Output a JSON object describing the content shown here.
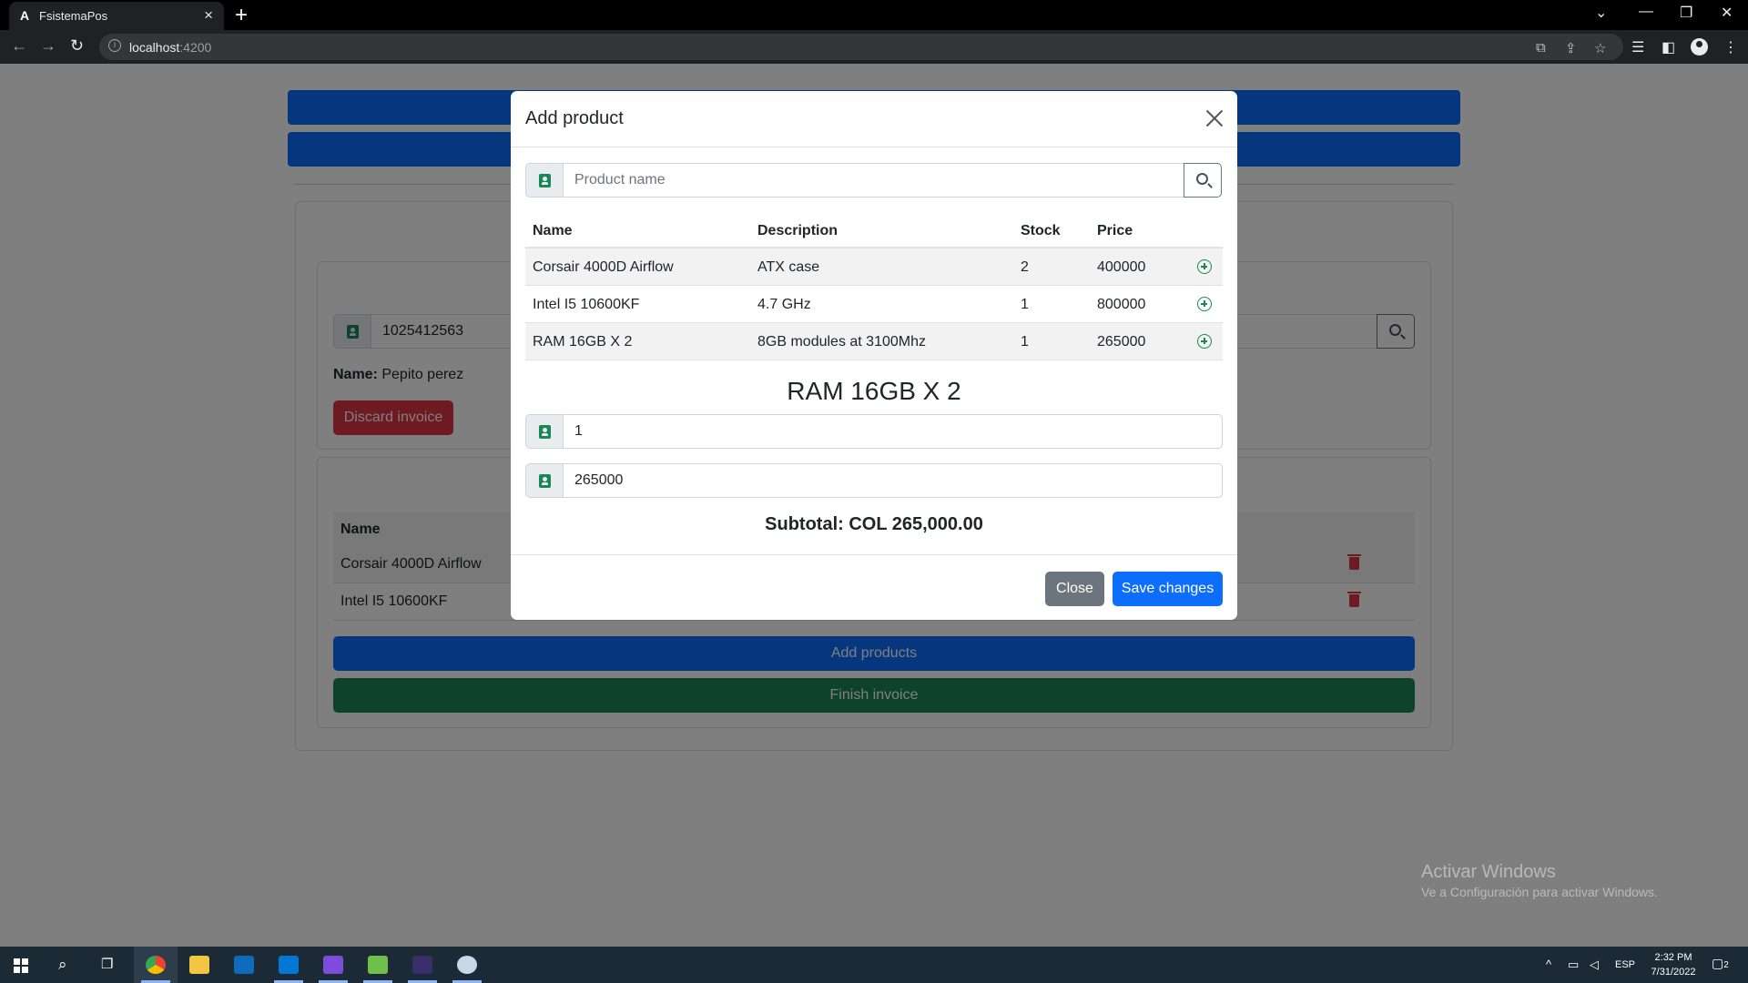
{
  "browser": {
    "tab_title": "FsistemaPos",
    "tab_favicon": "A",
    "url_host": "localhost",
    "url_port": ":4200"
  },
  "page": {
    "customer_id": "1025412563",
    "name_label": "Name:",
    "name_value": "Pepito perez",
    "discard_button": "Discard invoice",
    "invoice_table_header": "Name",
    "invoice_rows": [
      "Corsair 4000D Airflow",
      "Intel I5 10600KF"
    ],
    "add_products_button": "Add products",
    "finish_invoice_button": "Finish invoice"
  },
  "modal": {
    "title": "Add product",
    "search_placeholder": "Product name",
    "columns": [
      "Name",
      "Description",
      "Stock",
      "Price"
    ],
    "products": [
      {
        "name": "Corsair 4000D Airflow",
        "description": "ATX case",
        "stock": "2",
        "price": "400000"
      },
      {
        "name": "Intel I5 10600KF",
        "description": "4.7 GHz",
        "stock": "1",
        "price": "800000"
      },
      {
        "name": "RAM 16GB X 2",
        "description": "8GB modules at 3100Mhz",
        "stock": "1",
        "price": "265000"
      }
    ],
    "selected_product": "RAM 16GB X 2",
    "quantity": "1",
    "unit_price": "265000",
    "subtotal": "Subtotal: COL 265,000.00",
    "close_button": "Close",
    "save_button": "Save changes"
  },
  "watermark": {
    "line1": "Activar Windows",
    "line2": "Ve a Configuración para activar Windows."
  },
  "taskbar": {
    "lang": "ESP",
    "time": "2:32 PM",
    "date": "7/31/2022",
    "notifications": "2"
  },
  "colors": {
    "primary": "#0d6efd",
    "danger": "#dc3545",
    "success": "#198754",
    "secondary": "#6c757d"
  }
}
